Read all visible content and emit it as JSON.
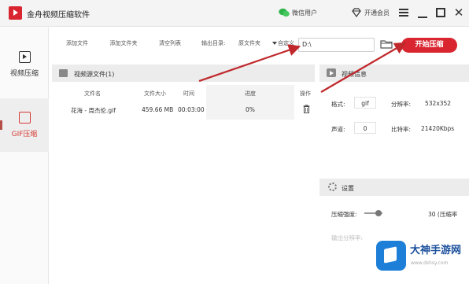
{
  "titlebar": {
    "app_title": "金舟视频压缩软件",
    "wechat_label": "微信用户",
    "vip_label": "开通会员"
  },
  "sidebar": {
    "items": [
      {
        "label": "视频压缩",
        "icon": "video-play-icon",
        "active": false
      },
      {
        "label": "GIF压缩",
        "icon": "gif-image-icon",
        "active": true
      }
    ]
  },
  "toolbar": {
    "add_file": "添加文件",
    "add_folder": "添加文件夹",
    "clear_list": "清空列表",
    "output_dir_label": "输出目录:",
    "output_dir_option": "原文件夹",
    "custom_label": "自定义",
    "path_value": "D:\\",
    "start_button": "开始压缩"
  },
  "file_panel": {
    "title": "视频源文件(1)",
    "columns": [
      "文件名",
      "文件大小",
      "时间",
      "进度",
      "操作"
    ],
    "rows": [
      {
        "name": "花海 - 周杰伦.gif",
        "size": "459.66 MB",
        "time": "00:03:00",
        "progress": "0%"
      }
    ]
  },
  "info_panel": {
    "title": "视频信息",
    "format_label": "格式:",
    "format_value": "gif",
    "resolution_label": "分辨率:",
    "resolution_value": "532x352",
    "channels_label": "声道:",
    "channels_value": "0",
    "bitrate_label": "比特率:",
    "bitrate_value": "21420Kbps"
  },
  "settings_panel": {
    "title": "设置",
    "compress_label": "压缩强度:",
    "compress_value": "30 (压缩率",
    "output_label": "输出分辨率:"
  },
  "watermark": {
    "title": "大神手游网",
    "url": "www.dshsy.com"
  },
  "colors": {
    "accent": "#d9252f",
    "annotation_arrow": "#c0282c",
    "active_sidebar": "#d53a33"
  }
}
